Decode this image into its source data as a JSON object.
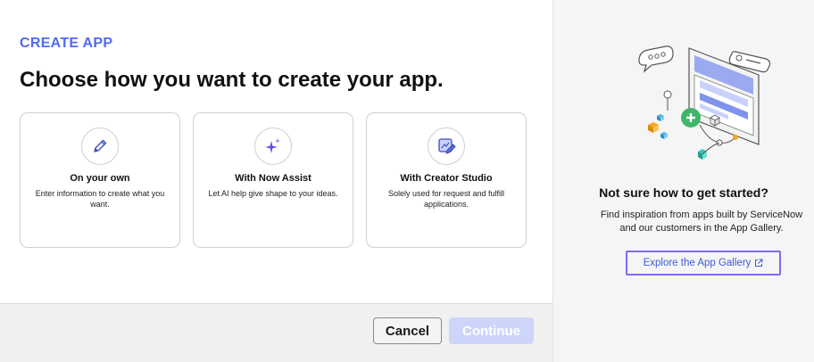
{
  "main": {
    "eyebrow": "CREATE APP",
    "heading": "Choose how you want to create your app.",
    "cards": [
      {
        "title": "On your own",
        "description": "Enter information to create what you want.",
        "icon": "pencil-icon"
      },
      {
        "title": "With Now Assist",
        "description": "Let AI help give shape to your ideas.",
        "icon": "sparkle-icon"
      },
      {
        "title": "With Creator Studio",
        "description": "Solely used for request and fulfill applications.",
        "icon": "creator-studio-icon"
      }
    ]
  },
  "footer": {
    "cancel_label": "Cancel",
    "continue_label": "Continue"
  },
  "sidebar": {
    "title": "Not sure how to get started?",
    "description": "Find inspiration from apps built by ServiceNow and our customers in the App Gallery.",
    "link_label": "Explore the App Gallery",
    "link_icon": "external-link-icon",
    "illustration_icon": "app-builder-illustration"
  },
  "colors": {
    "accent": "#4f6bed",
    "link": "#3c5bd8",
    "focus_ring": "#7b6cf6",
    "continue_disabled": "#cdd5fb"
  }
}
